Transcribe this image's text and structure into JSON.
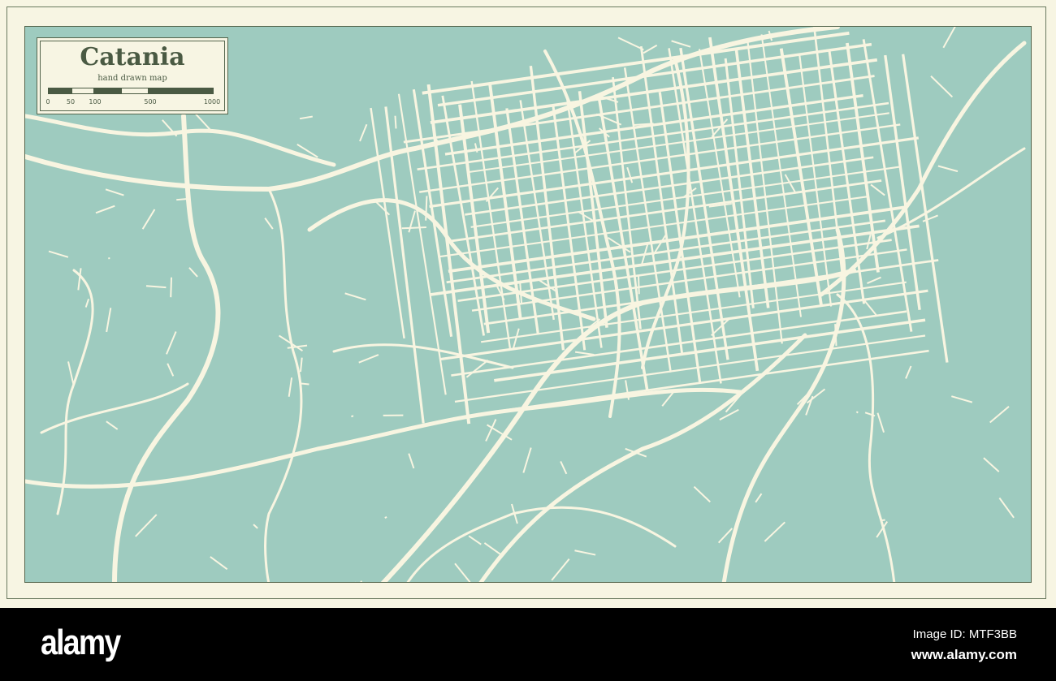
{
  "legend": {
    "title": "Catania",
    "subtitle": "hand drawn map",
    "scale_ticks": [
      "0",
      "50",
      "100",
      "500",
      "1000"
    ]
  },
  "colors": {
    "water": "#9ecbbf",
    "roads": "#f8f5e1",
    "frame": "#f7f5e3",
    "ink": "#4a5a43"
  },
  "footer": {
    "brand": "alamy",
    "image_id": "Image ID: MTF3BB",
    "site": "www.alamy.com"
  }
}
